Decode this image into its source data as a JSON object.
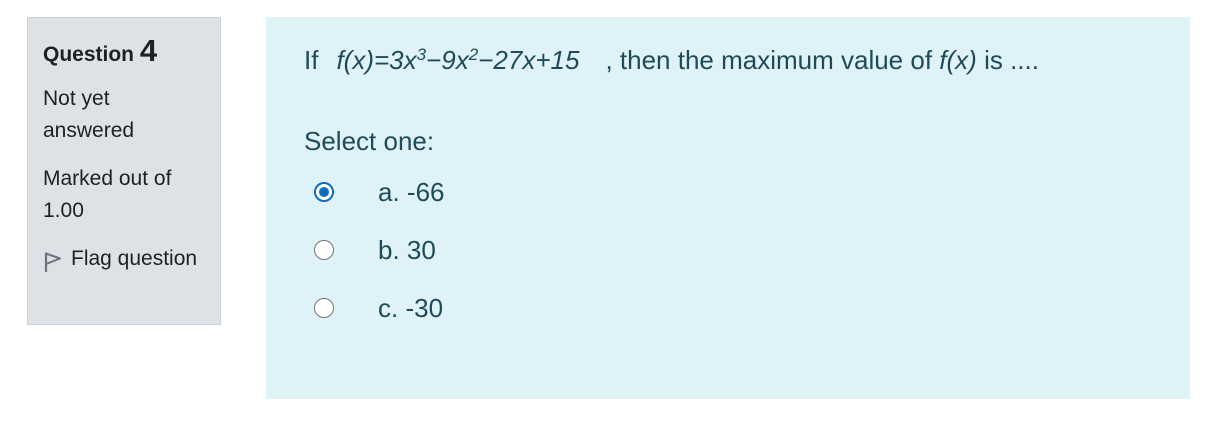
{
  "info": {
    "question_label": "Question",
    "question_number": "4",
    "state": "Not yet answered",
    "grade": "Marked out of 1.00",
    "flag_label": "Flag question",
    "flag_icon": "flag-icon"
  },
  "question": {
    "prefix": "If",
    "function_part1": "f(x)=3x",
    "exp1": "3",
    "function_part2": "−9x",
    "exp2": "2",
    "function_part3": "−27x+15",
    "suffix_start": ", then the maximum value of",
    "fx": "f(x)",
    "suffix_end": "is ....",
    "prompt": "Select one:",
    "answers": [
      {
        "label": "a. -66",
        "checked": true
      },
      {
        "label": "b. 30",
        "checked": false
      },
      {
        "label": "c. -30",
        "checked": false
      }
    ]
  },
  "colors": {
    "info_bg": "#dee2e6",
    "content_bg": "#def2f8",
    "accent": "#0f6cbf",
    "text": "#1f4b59"
  }
}
